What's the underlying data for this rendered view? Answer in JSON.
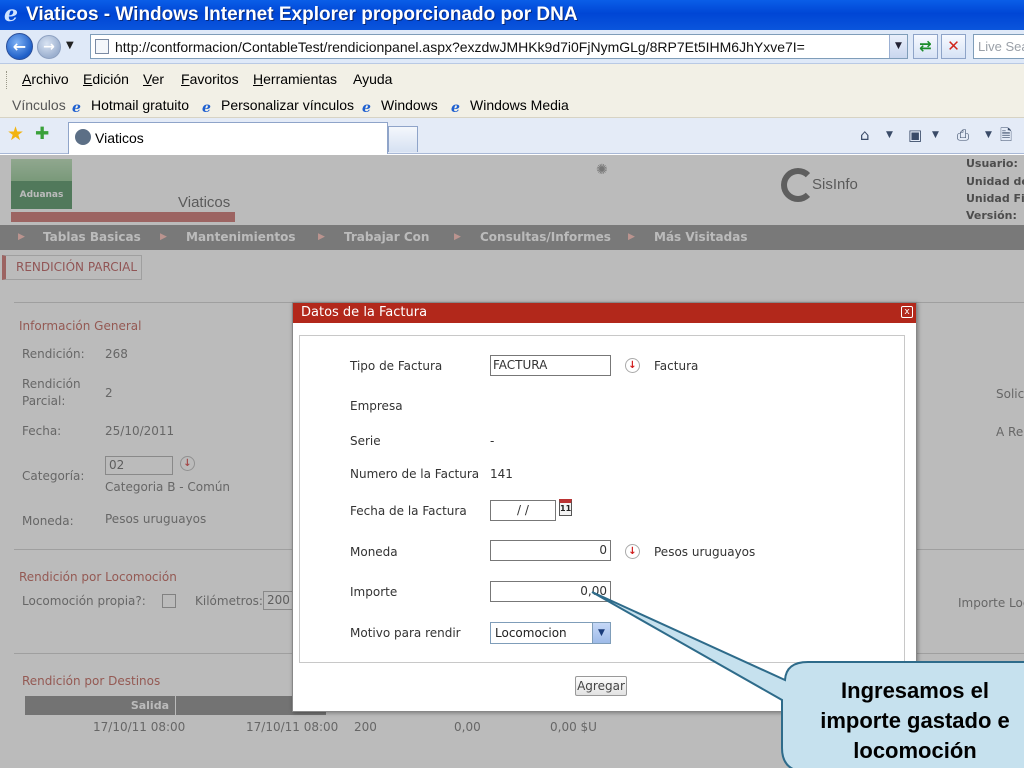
{
  "window": {
    "title": "Viaticos - Windows Internet Explorer proporcionado por DNA"
  },
  "address_bar": {
    "url": "http://contformacion/ContableTest/rendicionpanel.aspx?exzdwJMHKk9d7i0FjNymGLg/8RP7Et5IHM6JhYxve7I=",
    "search_placeholder": "Live Sea"
  },
  "menu": {
    "items": [
      {
        "label": "Archivo",
        "u": "A",
        "rest": "rchivo"
      },
      {
        "label": "Edición",
        "u": "E",
        "rest": "dición"
      },
      {
        "label": "Ver",
        "u": "V",
        "rest": "er"
      },
      {
        "label": "Favoritos",
        "u": "F",
        "rest": "avoritos"
      },
      {
        "label": "Herramientas",
        "u": "H",
        "rest": "erramientas"
      },
      {
        "label": "Ayuda",
        "u": "",
        "rest": "Ayuda"
      }
    ]
  },
  "links_bar": {
    "label": "Vínculos",
    "items": [
      "Hotmail gratuito",
      "Personalizar vínculos",
      "Windows",
      "Windows Media"
    ]
  },
  "tab": {
    "label": "Viaticos"
  },
  "page": {
    "logo_text": "Aduanas",
    "header_title": "Viaticos",
    "sisinfo": "SisInfo",
    "user_info": [
      "Usuario:",
      "Unidad de C",
      "Unidad Fina",
      "Versión:"
    ],
    "menu_strip": [
      "Tablas Basicas",
      "Mantenimientos",
      "Trabajar Con",
      "Consultas/Informes",
      "Más Visitadas"
    ],
    "rendicion_tab": "RENDICIÓN PARCIAL",
    "info_general": {
      "title": "Información General",
      "rendicion_label": "Rendición:",
      "rendicion_value": "268",
      "parcial_label_1": "Rendición",
      "parcial_label_2": "Parcial:",
      "parcial_value": "2",
      "fecha_label": "Fecha:",
      "fecha_value": "25/10/2011",
      "categoria_label": "Categoría:",
      "categoria_code": "02",
      "categoria_desc": "Categoria B - Común",
      "moneda_label": "Moneda:",
      "moneda_value": "Pesos uruguayos",
      "right_1": "Solic",
      "right_2": "A Ren"
    },
    "locomocion": {
      "title": "Rendición por Locomoción",
      "propia_label": "Locomoción propia?:",
      "km_label": "Kilómetros:",
      "km_value": "200",
      "importe_label": "Importe Loc"
    },
    "destinos": {
      "title": "Rendición por Destinos",
      "col_salida": "Salida",
      "col_llegada": "Ll",
      "row": {
        "salida": "17/10/11 08:00",
        "llegada": "17/10/11 08:00",
        "c3": "200",
        "c4": "0,00",
        "c5": "0,00 $U"
      }
    }
  },
  "modal": {
    "title": "Datos de la Factura",
    "close": "x",
    "tipo_label": "Tipo de Factura",
    "tipo_value": "FACTURA",
    "tipo_desc": "Factura",
    "empresa_label": "Empresa",
    "serie_label": "Serie",
    "serie_value": "-",
    "numero_label": "Numero de la Factura",
    "numero_value": "141",
    "fecha_label": "Fecha de la Factura",
    "fecha_value": "/  /",
    "cal_icon_text": "11",
    "moneda_label": "Moneda",
    "moneda_value": "0",
    "moneda_desc": "Pesos uruguayos",
    "importe_label": "Importe",
    "importe_value": "0,00",
    "motivo_label": "Motivo para rendir",
    "motivo_value": "Locomocion",
    "agregar": "Agregar"
  },
  "callout": {
    "line1": "Ingresamos el",
    "line2": "importe gastado e",
    "line3": "locomoción"
  },
  "colors": {
    "accent": "#b2281b",
    "title_bar": "#0a55dc",
    "callout_fill": "#c6e1ee",
    "callout_border": "#2e6b8a"
  }
}
